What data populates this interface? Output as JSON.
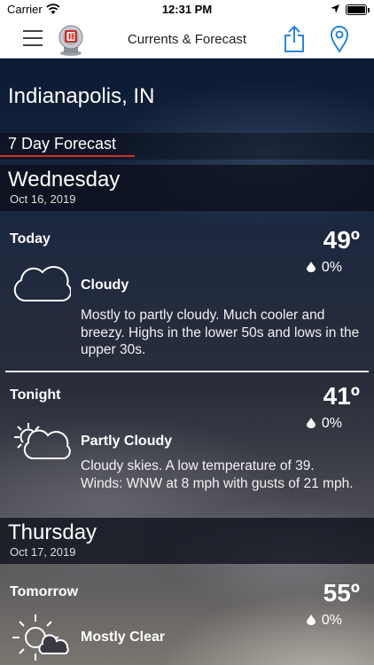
{
  "status_bar": {
    "carrier": "Carrier",
    "time": "12:31 PM"
  },
  "nav": {
    "title": "Currents & Forecast"
  },
  "location": "Indianapolis, IN",
  "section_label": "7 Day Forecast",
  "days": [
    {
      "day": "Wednesday",
      "date": "Oct 16, 2019",
      "periods": [
        {
          "name": "Today",
          "temp": "49º",
          "precip": "0%",
          "icon": "cloud-icon",
          "condition": "Cloudy",
          "description": "Mostly to partly cloudy. Much cooler and breezy. Highs in the lower 50s and lows in the upper 30s."
        },
        {
          "name": "Tonight",
          "temp": "41º",
          "precip": "0%",
          "icon": "partly-cloudy-icon",
          "condition": "Partly Cloudy",
          "description": "Cloudy skies.  A low temperature of 39. Winds: WNW at 8 mph with gusts of 21 mph."
        }
      ]
    },
    {
      "day": "Thursday",
      "date": "Oct 17, 2019",
      "periods": [
        {
          "name": "Tomorrow",
          "temp": "55º",
          "precip": "0%",
          "icon": "mostly-clear-icon",
          "condition": "Mostly Clear"
        }
      ]
    }
  ]
}
